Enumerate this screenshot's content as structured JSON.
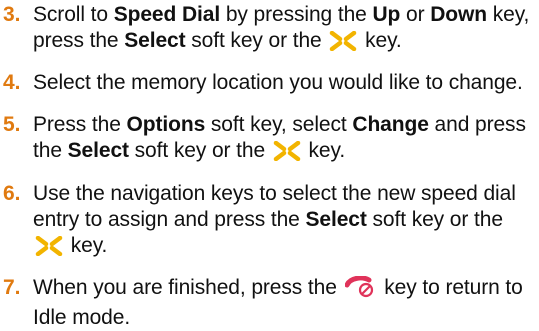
{
  "steps": [
    {
      "number": "3.",
      "t1": "Scroll to ",
      "b1": "Speed Dial",
      "t2": " by pressing the ",
      "b2": "Up",
      "t3": " or ",
      "b3": "Down",
      "t4": " key, press the ",
      "b4": "Select",
      "t5": " soft key or the ",
      "t6": " key."
    },
    {
      "number": "4.",
      "t1": "Select the memory location you would like to change."
    },
    {
      "number": "5.",
      "t1": "Press the ",
      "b1": "Options",
      "t2": " soft key, select ",
      "b2": "Change",
      "t3": " and press the ",
      "b3": "Select",
      "t4": " soft key or the ",
      "t5": " key."
    },
    {
      "number": "6.",
      "t1": "Use the navigation keys to select the new speed dial entry to assign and press the ",
      "b1": "Select",
      "t2": " soft key or the ",
      "t3": " key."
    },
    {
      "number": "7.",
      "t1": "When you are finished, press the ",
      "t2": " key to return to Idle mode."
    }
  ],
  "icons": {
    "nav_key": "navigation-key-icon",
    "end_key": "end-key-icon"
  },
  "colors": {
    "step_number": "#e07a10",
    "nav_key": "#f2b400",
    "end_key": "#e0335a"
  }
}
